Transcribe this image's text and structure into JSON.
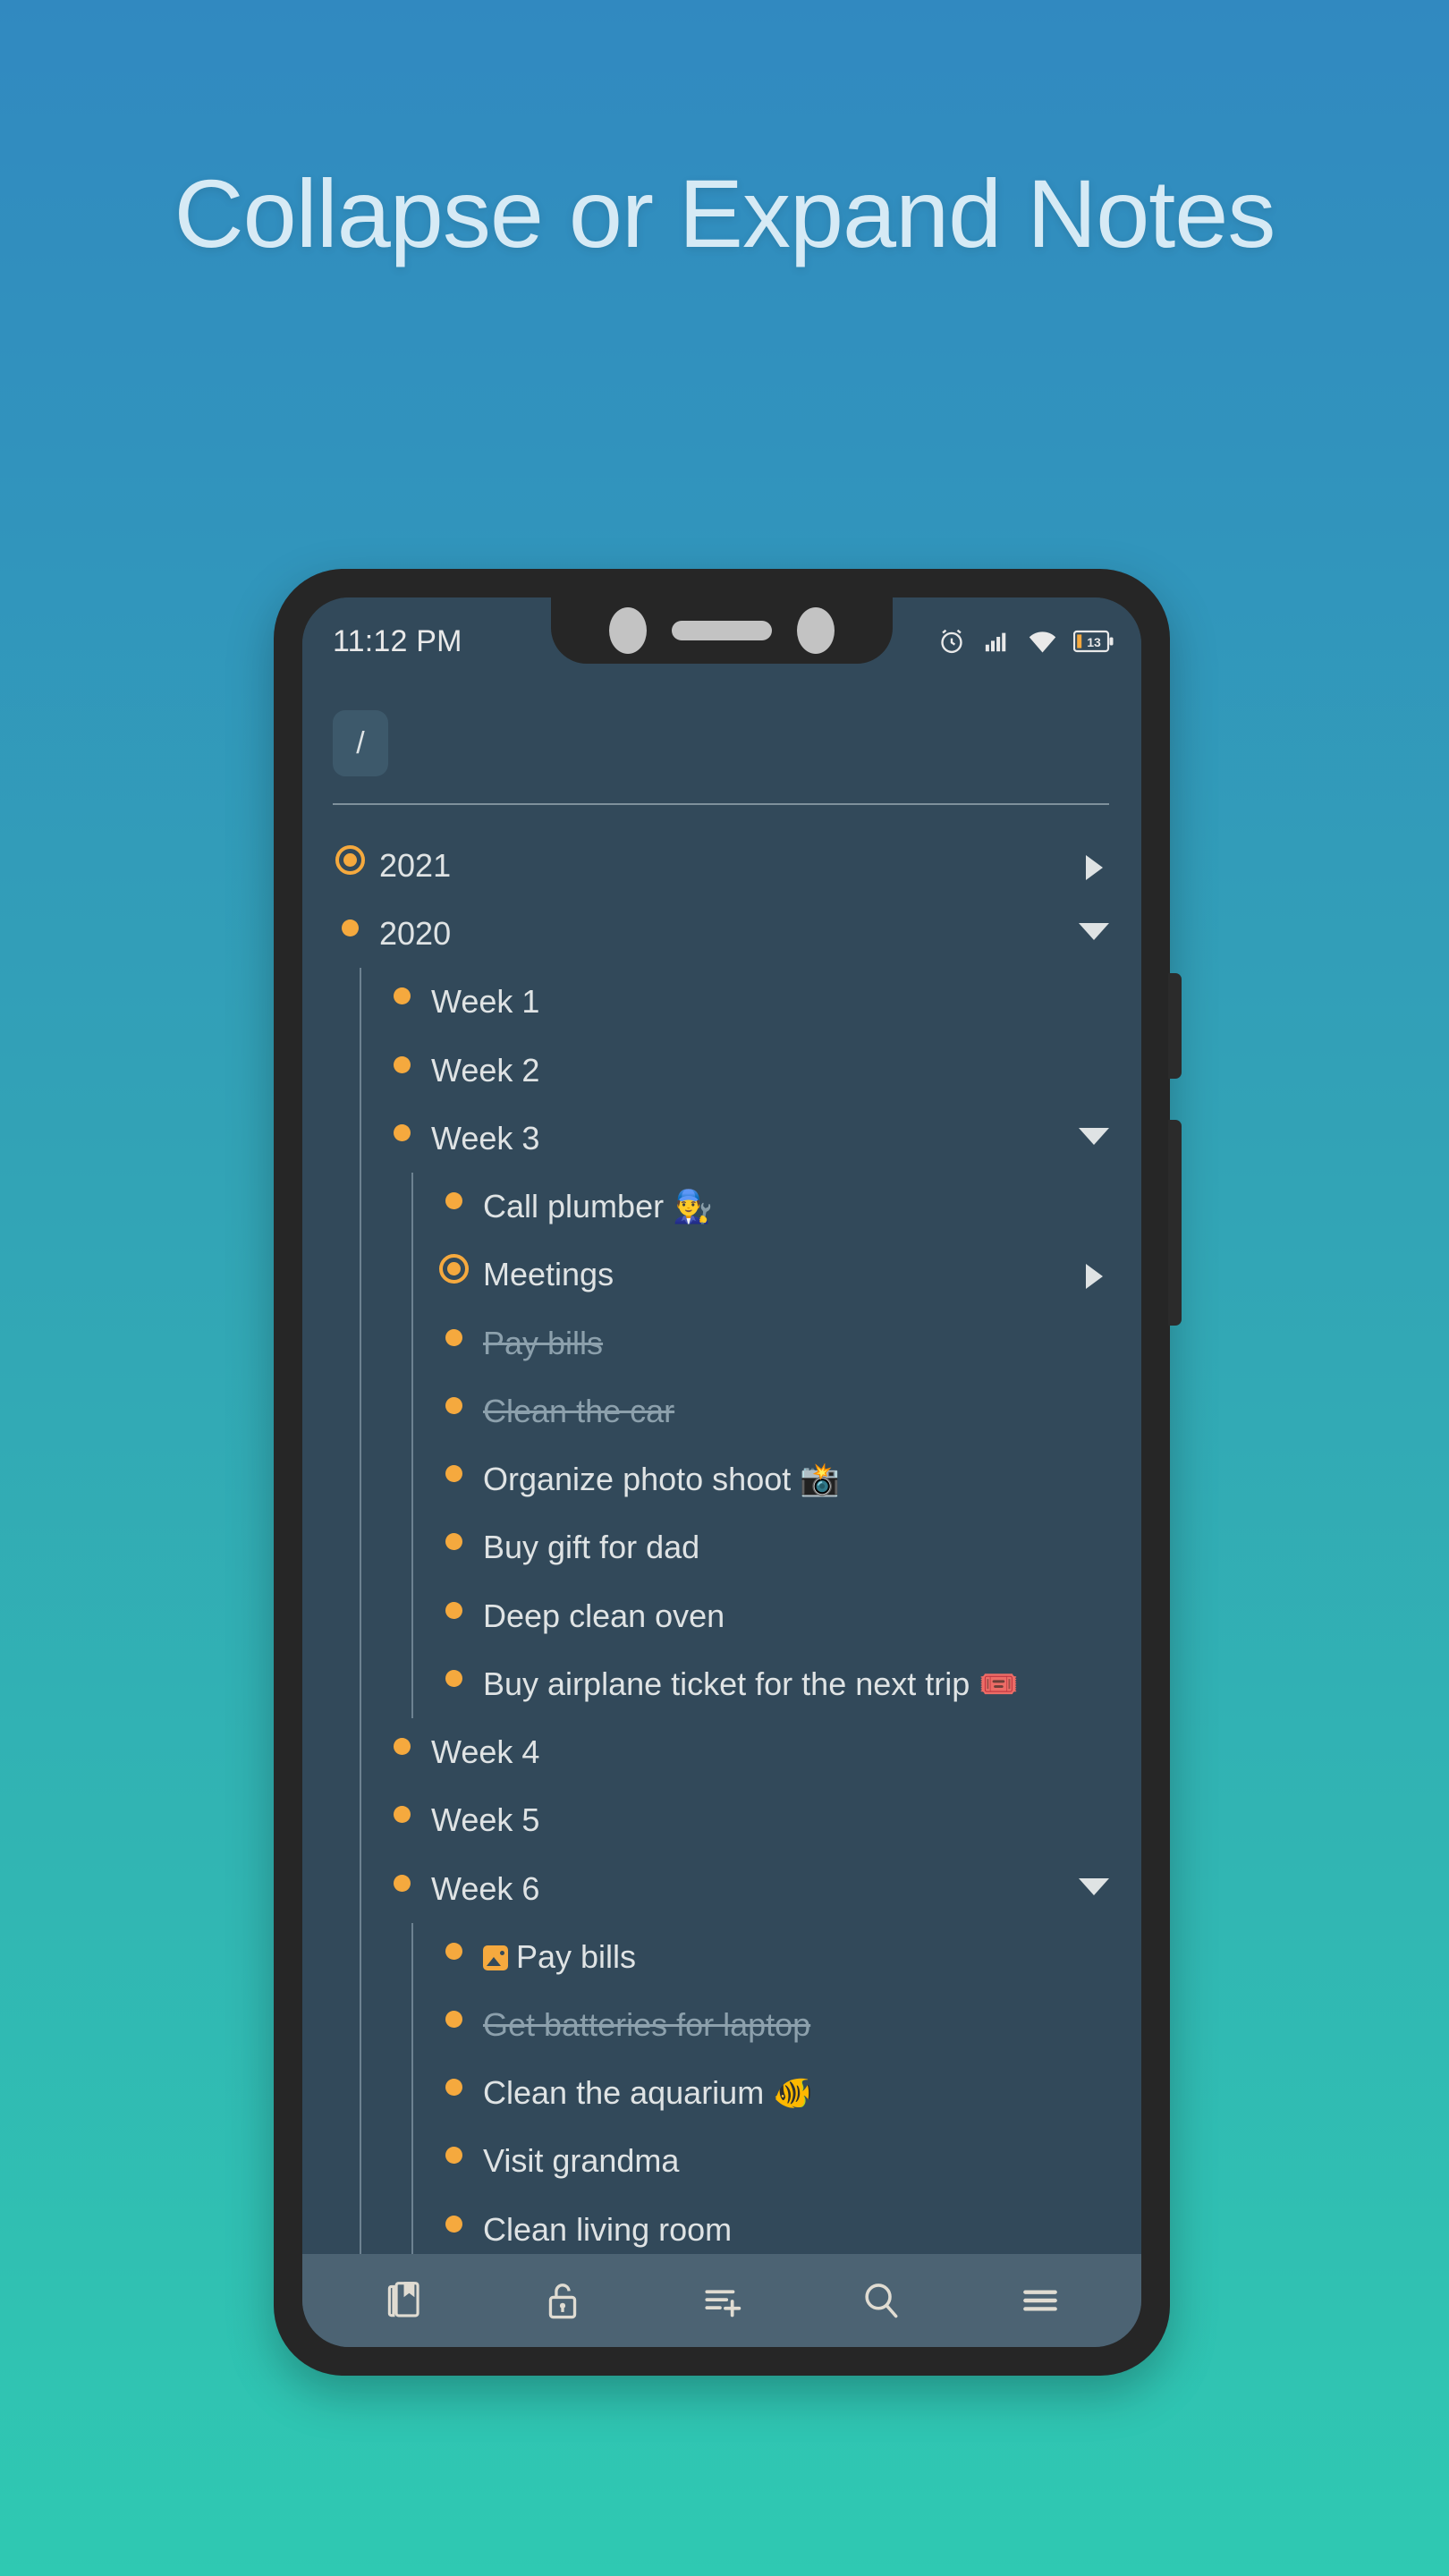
{
  "headline": "Collapse or Expand Notes",
  "colors": {
    "bg_top": "#3189c0",
    "bg_bottom": "#2fc9b2",
    "screen_bg": "#32495a",
    "bullet": "#f5a93e",
    "text": "#dfe3e4",
    "text_done": "#8ca0ac",
    "bottom_bar": "#4c6373",
    "headline": "#d6eaf5"
  },
  "status_bar": {
    "time": "11:12 PM",
    "battery_level": "13",
    "icons": [
      "alarm-icon",
      "signal-icon",
      "wifi-icon",
      "battery-icon"
    ]
  },
  "breadcrumb": {
    "path": "/"
  },
  "outline": [
    {
      "label": "2021",
      "level": 0,
      "bullet": "ring",
      "toggle": "collapsed",
      "done": false
    },
    {
      "label": "2020",
      "level": 0,
      "bullet": "dot",
      "toggle": "expanded",
      "done": false
    },
    {
      "label": "Week 1",
      "level": 1,
      "bullet": "dot",
      "toggle": "none",
      "done": false
    },
    {
      "label": "Week 2",
      "level": 1,
      "bullet": "dot",
      "toggle": "none",
      "done": false
    },
    {
      "label": "Week 3",
      "level": 1,
      "bullet": "dot",
      "toggle": "expanded",
      "done": false
    },
    {
      "label": "Call plumber 👨‍🔧",
      "level": 2,
      "bullet": "dot",
      "toggle": "none",
      "done": false
    },
    {
      "label": "Meetings",
      "level": 2,
      "bullet": "ring",
      "toggle": "collapsed",
      "done": false
    },
    {
      "label": "Pay bills",
      "level": 2,
      "bullet": "dot",
      "toggle": "none",
      "done": true
    },
    {
      "label": "Clean the car",
      "level": 2,
      "bullet": "dot",
      "toggle": "none",
      "done": true
    },
    {
      "label": "Organize photo shoot 📸",
      "level": 2,
      "bullet": "dot",
      "toggle": "none",
      "done": false
    },
    {
      "label": "Buy gift for dad",
      "level": 2,
      "bullet": "dot",
      "toggle": "none",
      "done": false
    },
    {
      "label": "Deep clean oven",
      "level": 2,
      "bullet": "dot",
      "toggle": "none",
      "done": false
    },
    {
      "label": "Buy airplane ticket for the next trip 🎟️",
      "level": 2,
      "bullet": "dot",
      "toggle": "none",
      "done": false
    },
    {
      "label": "Week 4",
      "level": 1,
      "bullet": "dot",
      "toggle": "none",
      "done": false
    },
    {
      "label": "Week 5",
      "level": 1,
      "bullet": "dot",
      "toggle": "none",
      "done": false
    },
    {
      "label": "Week 6",
      "level": 1,
      "bullet": "dot",
      "toggle": "expanded",
      "done": false
    },
    {
      "label": "Pay bills",
      "level": 2,
      "bullet": "dot",
      "toggle": "none",
      "done": false,
      "attachment": true
    },
    {
      "label": "Get batteries for laptop",
      "level": 2,
      "bullet": "dot",
      "toggle": "none",
      "done": true
    },
    {
      "label": "Clean the aquarium 🐠",
      "level": 2,
      "bullet": "dot",
      "toggle": "none",
      "done": false
    },
    {
      "label": "Visit grandma",
      "level": 2,
      "bullet": "dot",
      "toggle": "none",
      "done": false
    },
    {
      "label": "Clean living room",
      "level": 2,
      "bullet": "dot",
      "toggle": "none",
      "done": false
    }
  ],
  "bottom_bar": {
    "items": [
      {
        "name": "notebooks-icon",
        "label": "Notebooks"
      },
      {
        "name": "unlock-icon",
        "label": "Unlock"
      },
      {
        "name": "add-note-icon",
        "label": "Add note"
      },
      {
        "name": "search-icon",
        "label": "Search"
      },
      {
        "name": "menu-icon",
        "label": "Menu"
      }
    ]
  }
}
